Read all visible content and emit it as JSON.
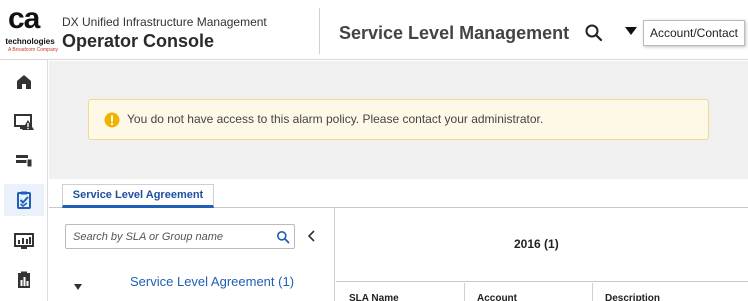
{
  "header": {
    "logo": {
      "mark": "ca",
      "line1": "technologies",
      "line2": "A Broadcom Company"
    },
    "app_subtitle": "DX Unified Infrastructure Management",
    "app_title": "Operator Console",
    "page_title": "Service Level Management",
    "icons": {
      "search": "search-icon",
      "dropdown": "caret-down-icon"
    },
    "account_label": "Account/Contact"
  },
  "left_nav": {
    "items": [
      {
        "name": "home",
        "icon": "home-icon",
        "active": false
      },
      {
        "name": "alarms",
        "icon": "monitor-alert-icon",
        "active": false
      },
      {
        "name": "inventory",
        "icon": "devices-icon",
        "active": false
      },
      {
        "name": "slm",
        "icon": "clipboard-check-icon",
        "active": true
      },
      {
        "name": "dashboards",
        "icon": "dashboard-icon",
        "active": false
      },
      {
        "name": "reports",
        "icon": "reports-icon",
        "active": false
      }
    ]
  },
  "alert": {
    "icon": "warning-icon",
    "message": "You do not have access to this alarm policy. Please contact your administrator."
  },
  "tabs": [
    {
      "label": "Service Level Agreement",
      "active": true
    }
  ],
  "sla_panel": {
    "search_placeholder": "Search by SLA or Group name",
    "tree": [
      {
        "label": "Service Level Agreement (1)",
        "expanded": true
      }
    ]
  },
  "detail": {
    "year_label": "2016 (1)",
    "columns": [
      "SLA Name",
      "Account",
      "Description"
    ]
  },
  "colors": {
    "accent": "#1f5fb8",
    "warning": "#f0b400",
    "alert_bg": "#fef9e6",
    "nav_active_bg": "#eaf1fb"
  }
}
